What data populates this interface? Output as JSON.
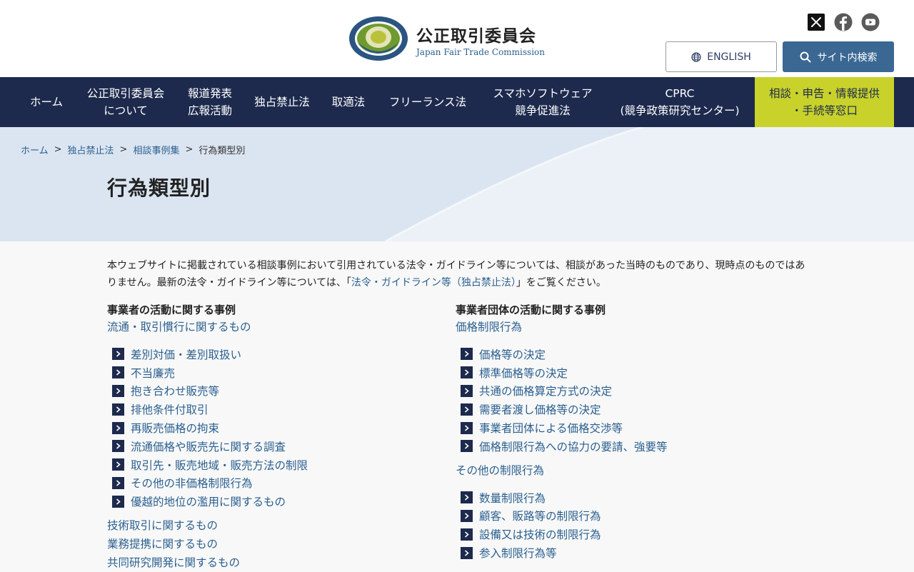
{
  "header": {
    "org_name": "公正取引委員会",
    "org_name_en": "Japan Fair Trade Commission",
    "logo_ring_text": "JAPAN FAIR TRADE COMMISSION",
    "english_label": "ENGLISH",
    "search_label": "サイト内検索",
    "social": [
      "x-icon",
      "facebook-icon",
      "youtube-icon"
    ]
  },
  "nav": {
    "items": [
      "ホーム",
      "公正取引委員会\nについて",
      "報道発表\n広報活動",
      "独占禁止法",
      "取適法",
      "フリーランス法",
      "スマホソフトウェア\n競争促進法",
      "CPRC\n(競争政策研究センター)",
      "相談・申告・情報提供\n・手続等窓口"
    ]
  },
  "breadcrumb": {
    "items": [
      "ホーム",
      "独占禁止法",
      "相談事例集"
    ],
    "current": "行為類型別",
    "separator": ">"
  },
  "page": {
    "title": "行為類型別"
  },
  "intro": {
    "text1": "本ウェブサイトに掲載されている相談事例において引用されている法令・ガイドライン等については、相談があった当時のものであり、現時点のものではありません。最新の法令・ガイドライン等については、「",
    "link": "法令・ガイドライン等（独占禁止法）",
    "text2": "」をご覧ください。"
  },
  "left": {
    "heading": "事業者の活動に関する事例",
    "group1": "流通・取引慣行に関するもの",
    "group1_items": [
      "差別対価・差別取扱い",
      "不当廉売",
      "抱き合わせ販売等",
      "排他条件付取引",
      "再販売価格の拘束",
      "流通価格や販売先に関する調査",
      "取引先・販売地域・販売方法の制限",
      "その他の非価格制限行為",
      "優越的地位の濫用に関するもの"
    ],
    "group2": "技術取引に関するもの",
    "group3": "業務提携に関するもの",
    "group4": "共同研究開発に関するもの"
  },
  "right": {
    "heading": "事業者団体の活動に関する事例",
    "group1": "価格制限行為",
    "group1_items": [
      "価格等の決定",
      "標準価格等の決定",
      "共通の価格算定方式の決定",
      "需要者渡し価格等の決定",
      "事業者団体による価格交渉等",
      "価格制限行為への協力の要請、強要等"
    ],
    "group2": "その他の制限行為",
    "group2_items": [
      "数量制限行為",
      "顧客、販路等の制限行為",
      "設備又は技術の制限行為",
      "参入制限行為等"
    ]
  },
  "colors": {
    "nav_bg": "#1d2a4d",
    "nav_accent": "#c8d22a",
    "link": "#2a5f8f",
    "search_btn": "#3a6893",
    "hero_bg": "#dbe5f1"
  }
}
